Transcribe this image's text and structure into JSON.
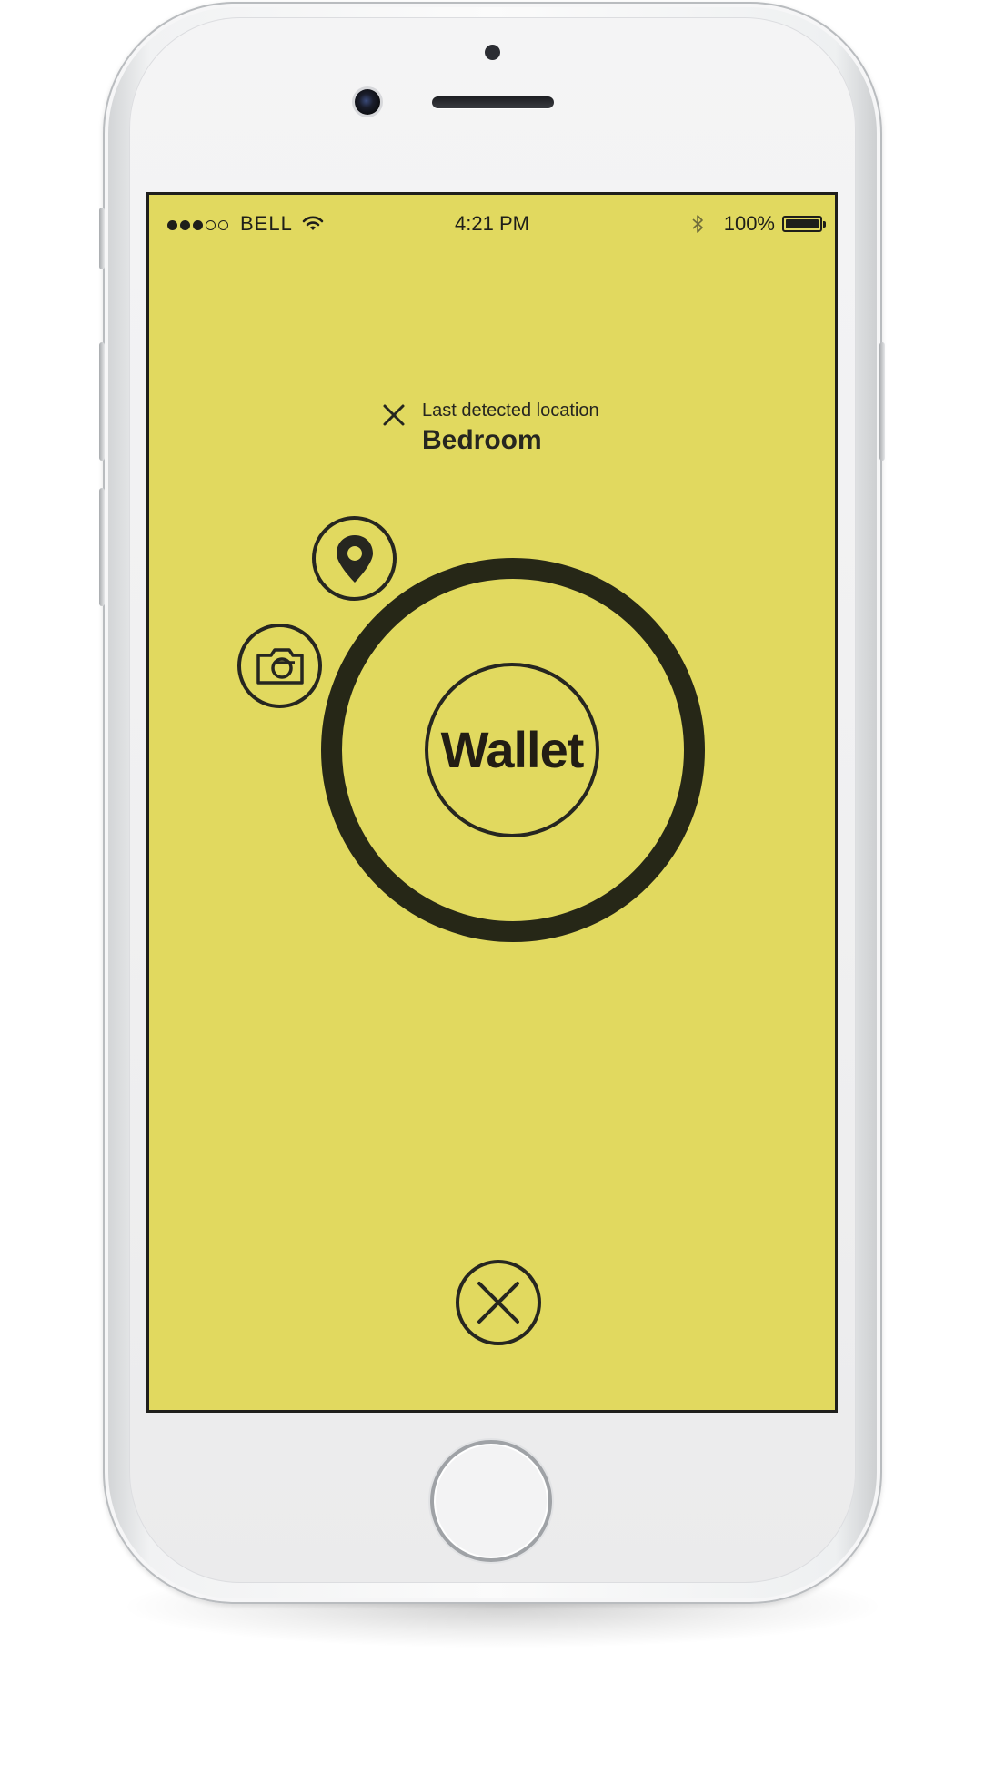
{
  "colors": {
    "screen_background": "#e1d95f",
    "foreground": "#262620",
    "ring": "#262717",
    "device_body": "#f2f2f3"
  },
  "status_bar": {
    "signal_bars_filled": 3,
    "signal_bars_total": 5,
    "carrier": "BELL",
    "wifi_icon": "wifi-icon",
    "time": "4:21 PM",
    "bluetooth_icon": "bluetooth-icon",
    "battery_percent": "100%",
    "battery_level": 1.0
  },
  "location": {
    "dismiss_icon": "close-icon",
    "caption": "Last detected location",
    "value": "Bedroom"
  },
  "actions": [
    {
      "name": "show-location",
      "icon": "map-pin-icon"
    },
    {
      "name": "take-photo",
      "icon": "camera-icon"
    }
  ],
  "item": {
    "name": "Wallet"
  },
  "close_button": {
    "icon": "close-circle-icon"
  }
}
